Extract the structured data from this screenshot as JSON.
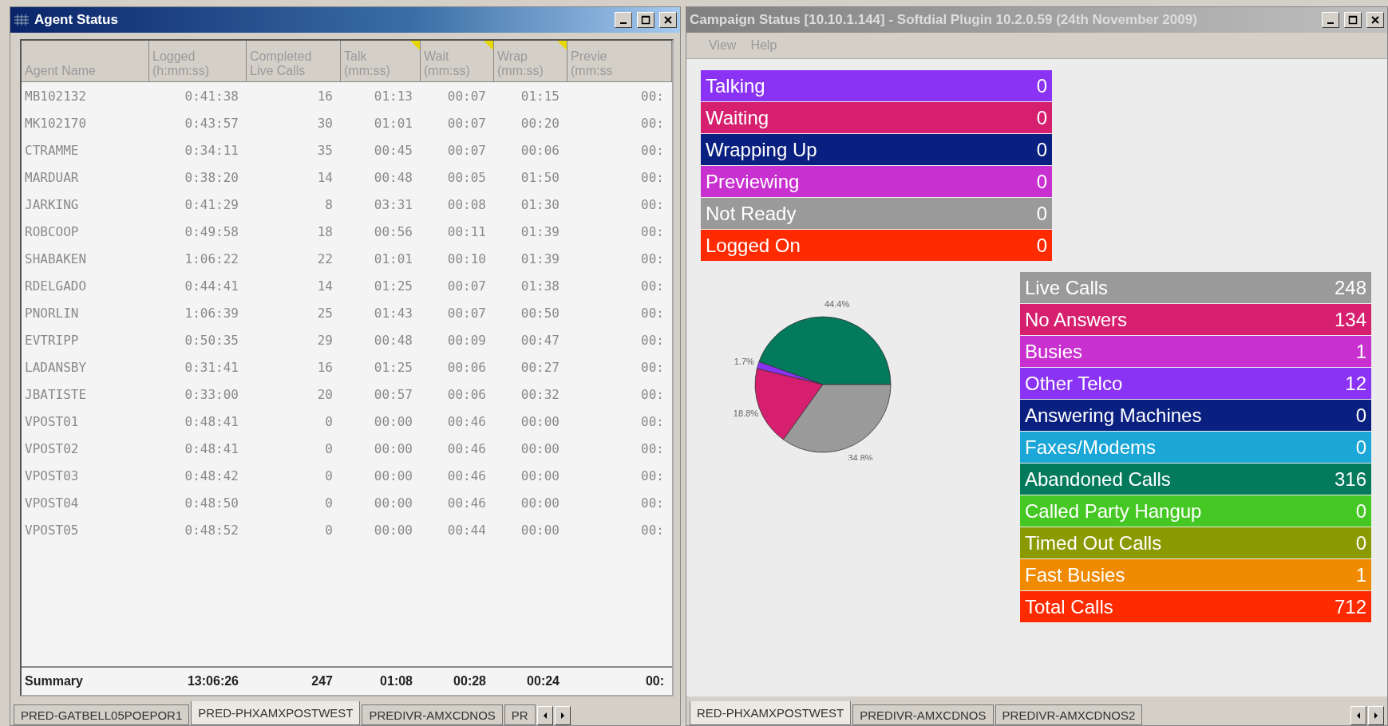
{
  "agent_window": {
    "title": "Agent Status",
    "table": {
      "columns": [
        {
          "line2": "Agent Name"
        },
        {
          "line1": "Logged",
          "line2": "(h:mm:ss)"
        },
        {
          "line1": "Completed",
          "line2": "Live Calls"
        },
        {
          "line1": "Talk",
          "line2": "(mm:ss)",
          "flag": true
        },
        {
          "line1": "Wait",
          "line2": "(mm:ss)",
          "flag": true
        },
        {
          "line1": "Wrap",
          "line2": "(mm:ss)",
          "flag": true
        },
        {
          "line1": "Previe",
          "line2": "(mm:ss"
        }
      ],
      "rows": [
        [
          "MB102132",
          "0:41:38",
          "16",
          "01:13",
          "00:07",
          "01:15",
          "00:"
        ],
        [
          "MK102170",
          "0:43:57",
          "30",
          "01:01",
          "00:07",
          "00:20",
          "00:"
        ],
        [
          "CTRAMME",
          "0:34:11",
          "35",
          "00:45",
          "00:07",
          "00:06",
          "00:"
        ],
        [
          "MARDUAR",
          "0:38:20",
          "14",
          "00:48",
          "00:05",
          "01:50",
          "00:"
        ],
        [
          "JARKING",
          "0:41:29",
          "8",
          "03:31",
          "00:08",
          "01:30",
          "00:"
        ],
        [
          "ROBCOOP",
          "0:49:58",
          "18",
          "00:56",
          "00:11",
          "01:39",
          "00:"
        ],
        [
          "SHABAKEN",
          "1:06:22",
          "22",
          "01:01",
          "00:10",
          "01:39",
          "00:"
        ],
        [
          "RDELGADO",
          "0:44:41",
          "14",
          "01:25",
          "00:07",
          "01:38",
          "00:"
        ],
        [
          "PNORLIN",
          "1:06:39",
          "25",
          "01:43",
          "00:07",
          "00:50",
          "00:"
        ],
        [
          "EVTRIPP",
          "0:50:35",
          "29",
          "00:48",
          "00:09",
          "00:47",
          "00:"
        ],
        [
          "LADANSBY",
          "0:31:41",
          "16",
          "01:25",
          "00:06",
          "00:27",
          "00:"
        ],
        [
          "JBATISTE",
          "0:33:00",
          "20",
          "00:57",
          "00:06",
          "00:32",
          "00:"
        ],
        [
          "VPOST01",
          "0:48:41",
          "0",
          "00:00",
          "00:46",
          "00:00",
          "00:"
        ],
        [
          "VPOST02",
          "0:48:41",
          "0",
          "00:00",
          "00:46",
          "00:00",
          "00:"
        ],
        [
          "VPOST03",
          "0:48:42",
          "0",
          "00:00",
          "00:46",
          "00:00",
          "00:"
        ],
        [
          "VPOST04",
          "0:48:50",
          "0",
          "00:00",
          "00:46",
          "00:00",
          "00:"
        ],
        [
          "VPOST05",
          "0:48:52",
          "0",
          "00:00",
          "00:44",
          "00:00",
          "00:"
        ]
      ],
      "summary": [
        "Summary",
        "13:06:26",
        "247",
        "01:08",
        "00:28",
        "00:24",
        "00:"
      ]
    },
    "tabs": [
      {
        "label": "PRED-GATBELL05POEPOR1",
        "selected": false
      },
      {
        "label": "PRED-PHXAMXPOSTWEST",
        "selected": true
      },
      {
        "label": "PREDIVR-AMXCDNOS",
        "selected": false
      },
      {
        "label": "PR",
        "selected": false
      }
    ]
  },
  "campaign_window": {
    "title": "Campaign Status [10.10.1.144] - Softdial Plugin 10.2.0.59 (24th November 2009)",
    "menu": [
      "View",
      "Help"
    ],
    "agent_states": [
      {
        "label": "Talking",
        "value": "0",
        "color": "#8a33f5"
      },
      {
        "label": "Waiting",
        "value": "0",
        "color": "#d61f6e"
      },
      {
        "label": "Wrapping Up",
        "value": "0",
        "color": "#0a2080"
      },
      {
        "label": "Previewing",
        "value": "0",
        "color": "#c830d0"
      },
      {
        "label": "Not Ready",
        "value": "0",
        "color": "#9a9a9a"
      },
      {
        "label": "Logged On",
        "value": "0",
        "color": "#ff2a00"
      }
    ],
    "chart_data": {
      "type": "pie",
      "values": [
        44.4,
        1.7,
        18.8,
        34.8
      ],
      "value_labels": [
        "44.4%",
        "1.7%",
        "18.8%",
        "34.8%"
      ]
    },
    "call_results": [
      {
        "label": "Live Calls",
        "value": "248",
        "color": "#9a9a9a"
      },
      {
        "label": "No Answers",
        "value": "134",
        "color": "#d61f6e"
      },
      {
        "label": "Busies",
        "value": "1",
        "color": "#c830d0"
      },
      {
        "label": "Other Telco",
        "value": "12",
        "color": "#8a33f5"
      },
      {
        "label": "Answering Machines",
        "value": "0",
        "color": "#0a2080"
      },
      {
        "label": "Faxes/Modems",
        "value": "0",
        "color": "#1aa6d6"
      },
      {
        "label": "Abandoned Calls",
        "value": "316",
        "color": "#047a5c"
      },
      {
        "label": "Called Party Hangup",
        "value": "0",
        "color": "#45c823"
      },
      {
        "label": "Timed Out Calls",
        "value": "0",
        "color": "#8a9a00"
      },
      {
        "label": "Fast Busies",
        "value": "1",
        "color": "#f08a00"
      },
      {
        "label": "Total Calls",
        "value": "712",
        "color": "#ff2a00"
      }
    ],
    "tabs": [
      {
        "label": "RED-PHXAMXPOSTWEST",
        "selected": true
      },
      {
        "label": "PREDIVR-AMXCDNOS",
        "selected": false
      },
      {
        "label": "PREDIVR-AMXCDNOS2",
        "selected": false
      }
    ]
  }
}
